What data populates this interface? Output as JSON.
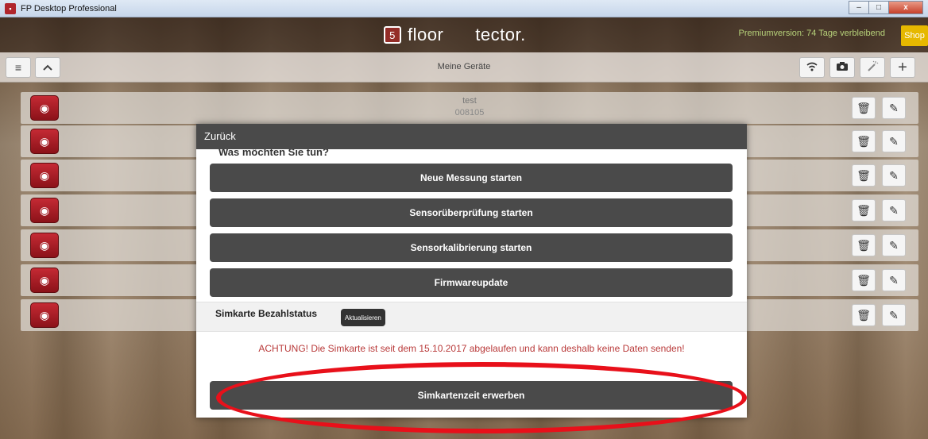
{
  "window": {
    "title": "FP Desktop Professional",
    "minimize": "–",
    "maximize": "□",
    "close": "x"
  },
  "header": {
    "logo_part1": "floor",
    "logo_part2": "tector.",
    "logo_mark": "5",
    "premium": "Premiumversion: 74 Tage verbleibend",
    "shop": "Shop"
  },
  "toolbar": {
    "title": "Meine Geräte",
    "menu_icon": "≡",
    "up_icon": "^",
    "wifi_icon": "wifi-icon",
    "camera_icon": "camera-icon",
    "magic_icon": "magic-icon",
    "add_icon": "+"
  },
  "devices": [
    {
      "name": "test",
      "id": "008105"
    },
    {
      "name": "",
      "id": ""
    },
    {
      "name": "",
      "id": ""
    },
    {
      "name": "",
      "id": ""
    },
    {
      "name": "",
      "id": ""
    },
    {
      "name": "",
      "id": ""
    },
    {
      "name": "",
      "id": ""
    }
  ],
  "modal": {
    "back": "Zurück",
    "subtitle": "Was möchten Sie tun?",
    "buttons": [
      "Neue Messung starten",
      "Sensorüberprüfung starten",
      "Sensorkalibrierung starten",
      "Firmwareupdate"
    ],
    "sim_label": "Simkarte Bezahlstatus",
    "sim_refresh": "Aktualisieren",
    "warning": "ACHTUNG! Die Simkarte ist seit dem 15.10.2017 abgelaufen und kann deshalb keine Daten senden!",
    "buy_button": "Simkartenzeit erwerben"
  },
  "colors": {
    "accent_dark": "#4a4a4a",
    "warning": "#b93a3a",
    "highlight": "#e8101a",
    "shop": "#e6b800"
  }
}
